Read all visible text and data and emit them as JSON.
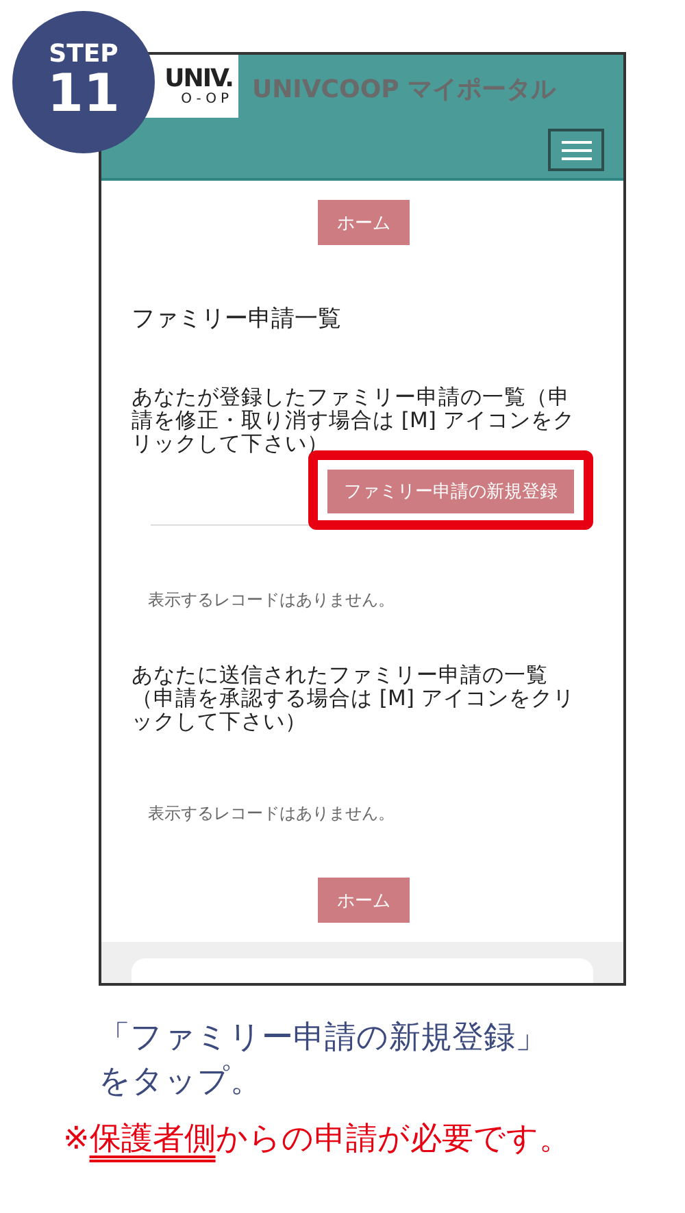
{
  "step": {
    "label": "STEP",
    "number": "11"
  },
  "header": {
    "logo_line1": "UNIV.",
    "logo_line2": "O-OP",
    "title": "UNIVCOOP マイポータル"
  },
  "home_button_top": "ホーム",
  "page_title": "ファミリー申請一覧",
  "sections": [
    {
      "description_lines": [
        "あなたが登録したファミリー申請の一覧（申",
        "請を修正・取り消す場合は [M] アイコンをク",
        "リックして下さい）"
      ],
      "action_button": {
        "label": "ファミリー申請の新規登録",
        "highlighted": true
      },
      "empty_message": "表示するレコードはありません。"
    },
    {
      "description_lines": [
        "あなたに送信されたファミリー申請の一覧",
        "（申請を承認する場合は [M] アイコンをクリ",
        "ックして下さい）"
      ],
      "empty_message": "表示するレコードはありません。"
    }
  ],
  "home_button_bottom": "ホーム",
  "instruction_lines": [
    "「ファミリー申請の新規登録」",
    "をタップ。"
  ],
  "note_parts": [
    {
      "text": "※",
      "underline": false
    },
    {
      "text": "保護者側",
      "underline": true
    },
    {
      "text": "からの申請が必要です。",
      "underline": false
    }
  ]
}
